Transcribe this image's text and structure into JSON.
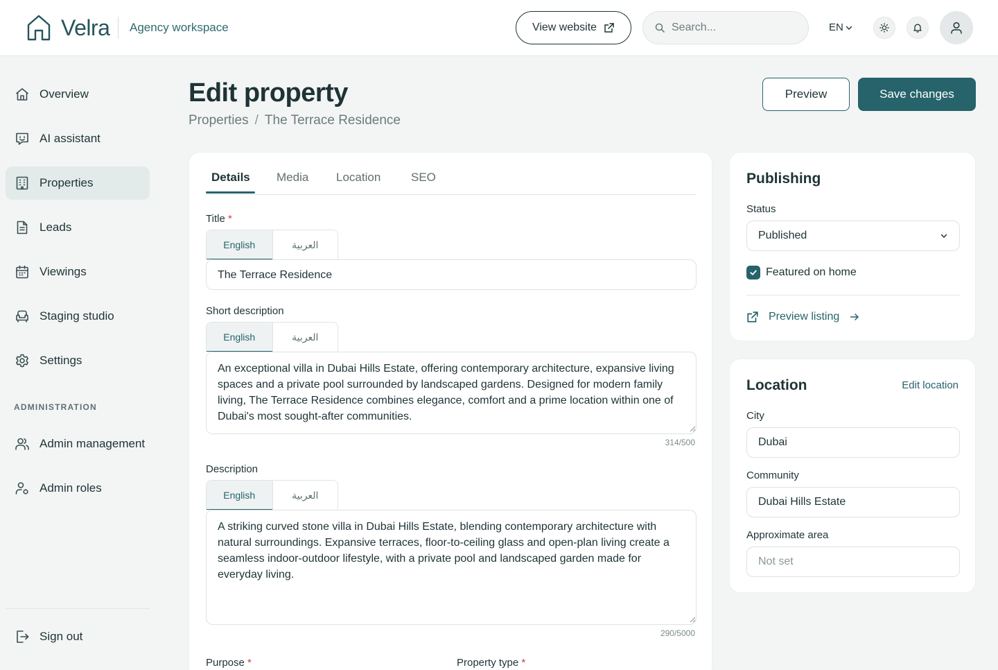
{
  "header": {
    "brand": "Velra",
    "workspace": "Agency workspace",
    "view_website": "View website",
    "search_placeholder": "Search...",
    "language": "EN"
  },
  "sidebar": {
    "items": [
      {
        "label": "Overview",
        "icon": "home-icon"
      },
      {
        "label": "AI assistant",
        "icon": "chat-bot-icon"
      },
      {
        "label": "Properties",
        "icon": "building-icon",
        "active": true
      },
      {
        "label": "Leads",
        "icon": "document-icon"
      },
      {
        "label": "Viewings",
        "icon": "calendar-icon"
      },
      {
        "label": "Staging studio",
        "icon": "armchair-icon"
      },
      {
        "label": "Settings",
        "icon": "gear-icon"
      }
    ],
    "admin_heading": "ADMINISTRATION",
    "admin_items": [
      {
        "label": "Admin management",
        "icon": "users-icon"
      },
      {
        "label": "Admin roles",
        "icon": "user-role-icon"
      }
    ],
    "sign_out": "Sign out"
  },
  "page": {
    "title": "Edit property",
    "breadcrumb": {
      "parent": "Properties",
      "separator": "/",
      "current": "The Terrace Residence"
    },
    "preview_button": "Preview",
    "save_button": "Save changes"
  },
  "tabs": [
    "Details",
    "Media",
    "Location",
    "SEO"
  ],
  "form": {
    "title_label": "Title",
    "required_mark": "*",
    "lang_en": "English",
    "lang_ar": "العربية",
    "title_value": "The Terrace Residence",
    "short_description_label": "Short description",
    "short_description_value": "An exceptional villa in Dubai Hills Estate, offering contemporary architecture, expansive living spaces and a private pool surrounded by landscaped gardens. Designed for modern family living, The Terrace Residence combines elegance, comfort and a prime location within one of Dubai's most sought-after communities.",
    "short_description_counter": "314/500",
    "description_label": "Description",
    "description_value": "A striking curved stone villa in Dubai Hills Estate, blending contemporary architecture with natural surroundings. Expansive terraces, floor-to-ceiling glass and open-plan living create a seamless indoor-outdoor lifestyle, with a private pool and landscaped garden made for everyday living.",
    "description_counter": "290/5000",
    "purpose_label": "Purpose",
    "property_type_label": "Property type"
  },
  "publishing": {
    "title": "Publishing",
    "status_label": "Status",
    "status_value": "Published",
    "featured_label": "Featured on home",
    "featured_checked": true,
    "preview_listing": "Preview listing"
  },
  "location": {
    "title": "Location",
    "edit_link": "Edit location",
    "city_label": "City",
    "city_value": "Dubai",
    "community_label": "Community",
    "community_value": "Dubai Hills Estate",
    "area_label": "Approximate area",
    "area_placeholder": "Not set"
  },
  "colors": {
    "accent": "#26636b",
    "background": "#f3f5f4",
    "text": "#1e3335",
    "required": "#c9433f"
  }
}
